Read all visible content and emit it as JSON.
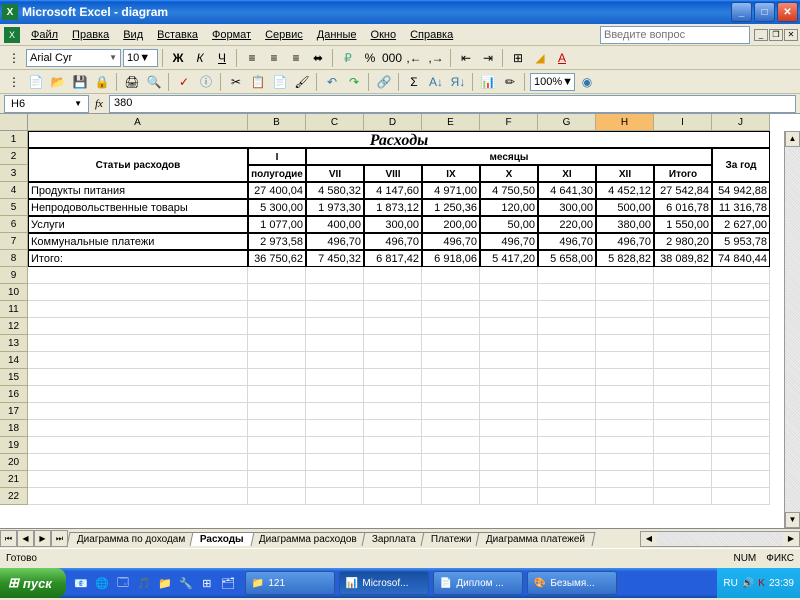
{
  "window": {
    "title": "Microsoft Excel - diagram"
  },
  "menu": {
    "file": "Файл",
    "edit": "Правка",
    "view": "Вид",
    "insert": "Вставка",
    "format": "Формат",
    "tools": "Сервис",
    "data": "Данные",
    "window": "Окно",
    "help": "Справка",
    "question_placeholder": "Введите вопрос"
  },
  "formatbar": {
    "font": "Arial Cyr",
    "size": "10",
    "zoom": "100%"
  },
  "namebox": {
    "cell": "H6",
    "formula": "380"
  },
  "cols": [
    "A",
    "B",
    "C",
    "D",
    "E",
    "F",
    "G",
    "H",
    "I",
    "J"
  ],
  "rows_visible": 22,
  "selected_col": "H",
  "selected_row": 6,
  "table": {
    "title": "Расходы",
    "h_stati": "Статьи расходов",
    "h_1pol": "I",
    "h_1pol2": "полугодие",
    "h_mes": "месяцы",
    "h_god": "За год",
    "months": [
      "VII",
      "VIII",
      "IX",
      "X",
      "XI",
      "XII",
      "Итого"
    ],
    "rows": [
      {
        "label": "Продукты питания",
        "vals": [
          "27 400,04",
          "4 580,32",
          "4 147,60",
          "4 971,00",
          "4 750,50",
          "4 641,30",
          "4 452,12",
          "27 542,84",
          "54 942,88"
        ]
      },
      {
        "label": "Непродовольственные товары",
        "vals": [
          "5 300,00",
          "1 973,30",
          "1 873,12",
          "1 250,36",
          "120,00",
          "300,00",
          "500,00",
          "6 016,78",
          "11 316,78"
        ]
      },
      {
        "label": "Услуги",
        "vals": [
          "1 077,00",
          "400,00",
          "300,00",
          "200,00",
          "50,00",
          "220,00",
          "380,00",
          "1 550,00",
          "2 627,00"
        ]
      },
      {
        "label": "Коммунальные платежи",
        "vals": [
          "2 973,58",
          "496,70",
          "496,70",
          "496,70",
          "496,70",
          "496,70",
          "496,70",
          "2 980,20",
          "5 953,78"
        ]
      },
      {
        "label": "Итого:",
        "vals": [
          "36 750,62",
          "7 450,32",
          "6 817,42",
          "6 918,06",
          "5 417,20",
          "5 658,00",
          "5 828,82",
          "38 089,82",
          "74 840,44"
        ]
      }
    ]
  },
  "tabs": {
    "items": [
      "Диаграмма по доходам",
      "Расходы",
      "Диаграмма расходов",
      "Зарплата",
      "Платежи",
      "Диаграмма платежей"
    ],
    "active": "Расходы"
  },
  "status": {
    "ready": "Готово",
    "num": "NUM",
    "fix": "ФИКС"
  },
  "taskbar": {
    "start": "пуск",
    "folder": "121",
    "items": [
      "Microsof...",
      "Диплом ...",
      "Безымя..."
    ],
    "lang": "RU",
    "time": "23:39"
  },
  "chart_data": {
    "type": "table",
    "title": "Расходы",
    "columns": [
      "Статьи расходов",
      "I полугодие",
      "VII",
      "VIII",
      "IX",
      "X",
      "XI",
      "XII",
      "Итого",
      "За год"
    ],
    "rows": [
      [
        "Продукты питания",
        27400.04,
        4580.32,
        4147.6,
        4971.0,
        4750.5,
        4641.3,
        4452.12,
        27542.84,
        54942.88
      ],
      [
        "Непродовольственные товары",
        5300.0,
        1973.3,
        1873.12,
        1250.36,
        120.0,
        300.0,
        500.0,
        6016.78,
        11316.78
      ],
      [
        "Услуги",
        1077.0,
        400.0,
        300.0,
        200.0,
        50.0,
        220.0,
        380.0,
        1550.0,
        2627.0
      ],
      [
        "Коммунальные платежи",
        2973.58,
        496.7,
        496.7,
        496.7,
        496.7,
        496.7,
        496.7,
        2980.2,
        5953.78
      ],
      [
        "Итого:",
        36750.62,
        7450.32,
        6817.42,
        6918.06,
        5417.2,
        5658.0,
        5828.82,
        38089.82,
        74840.44
      ]
    ]
  }
}
